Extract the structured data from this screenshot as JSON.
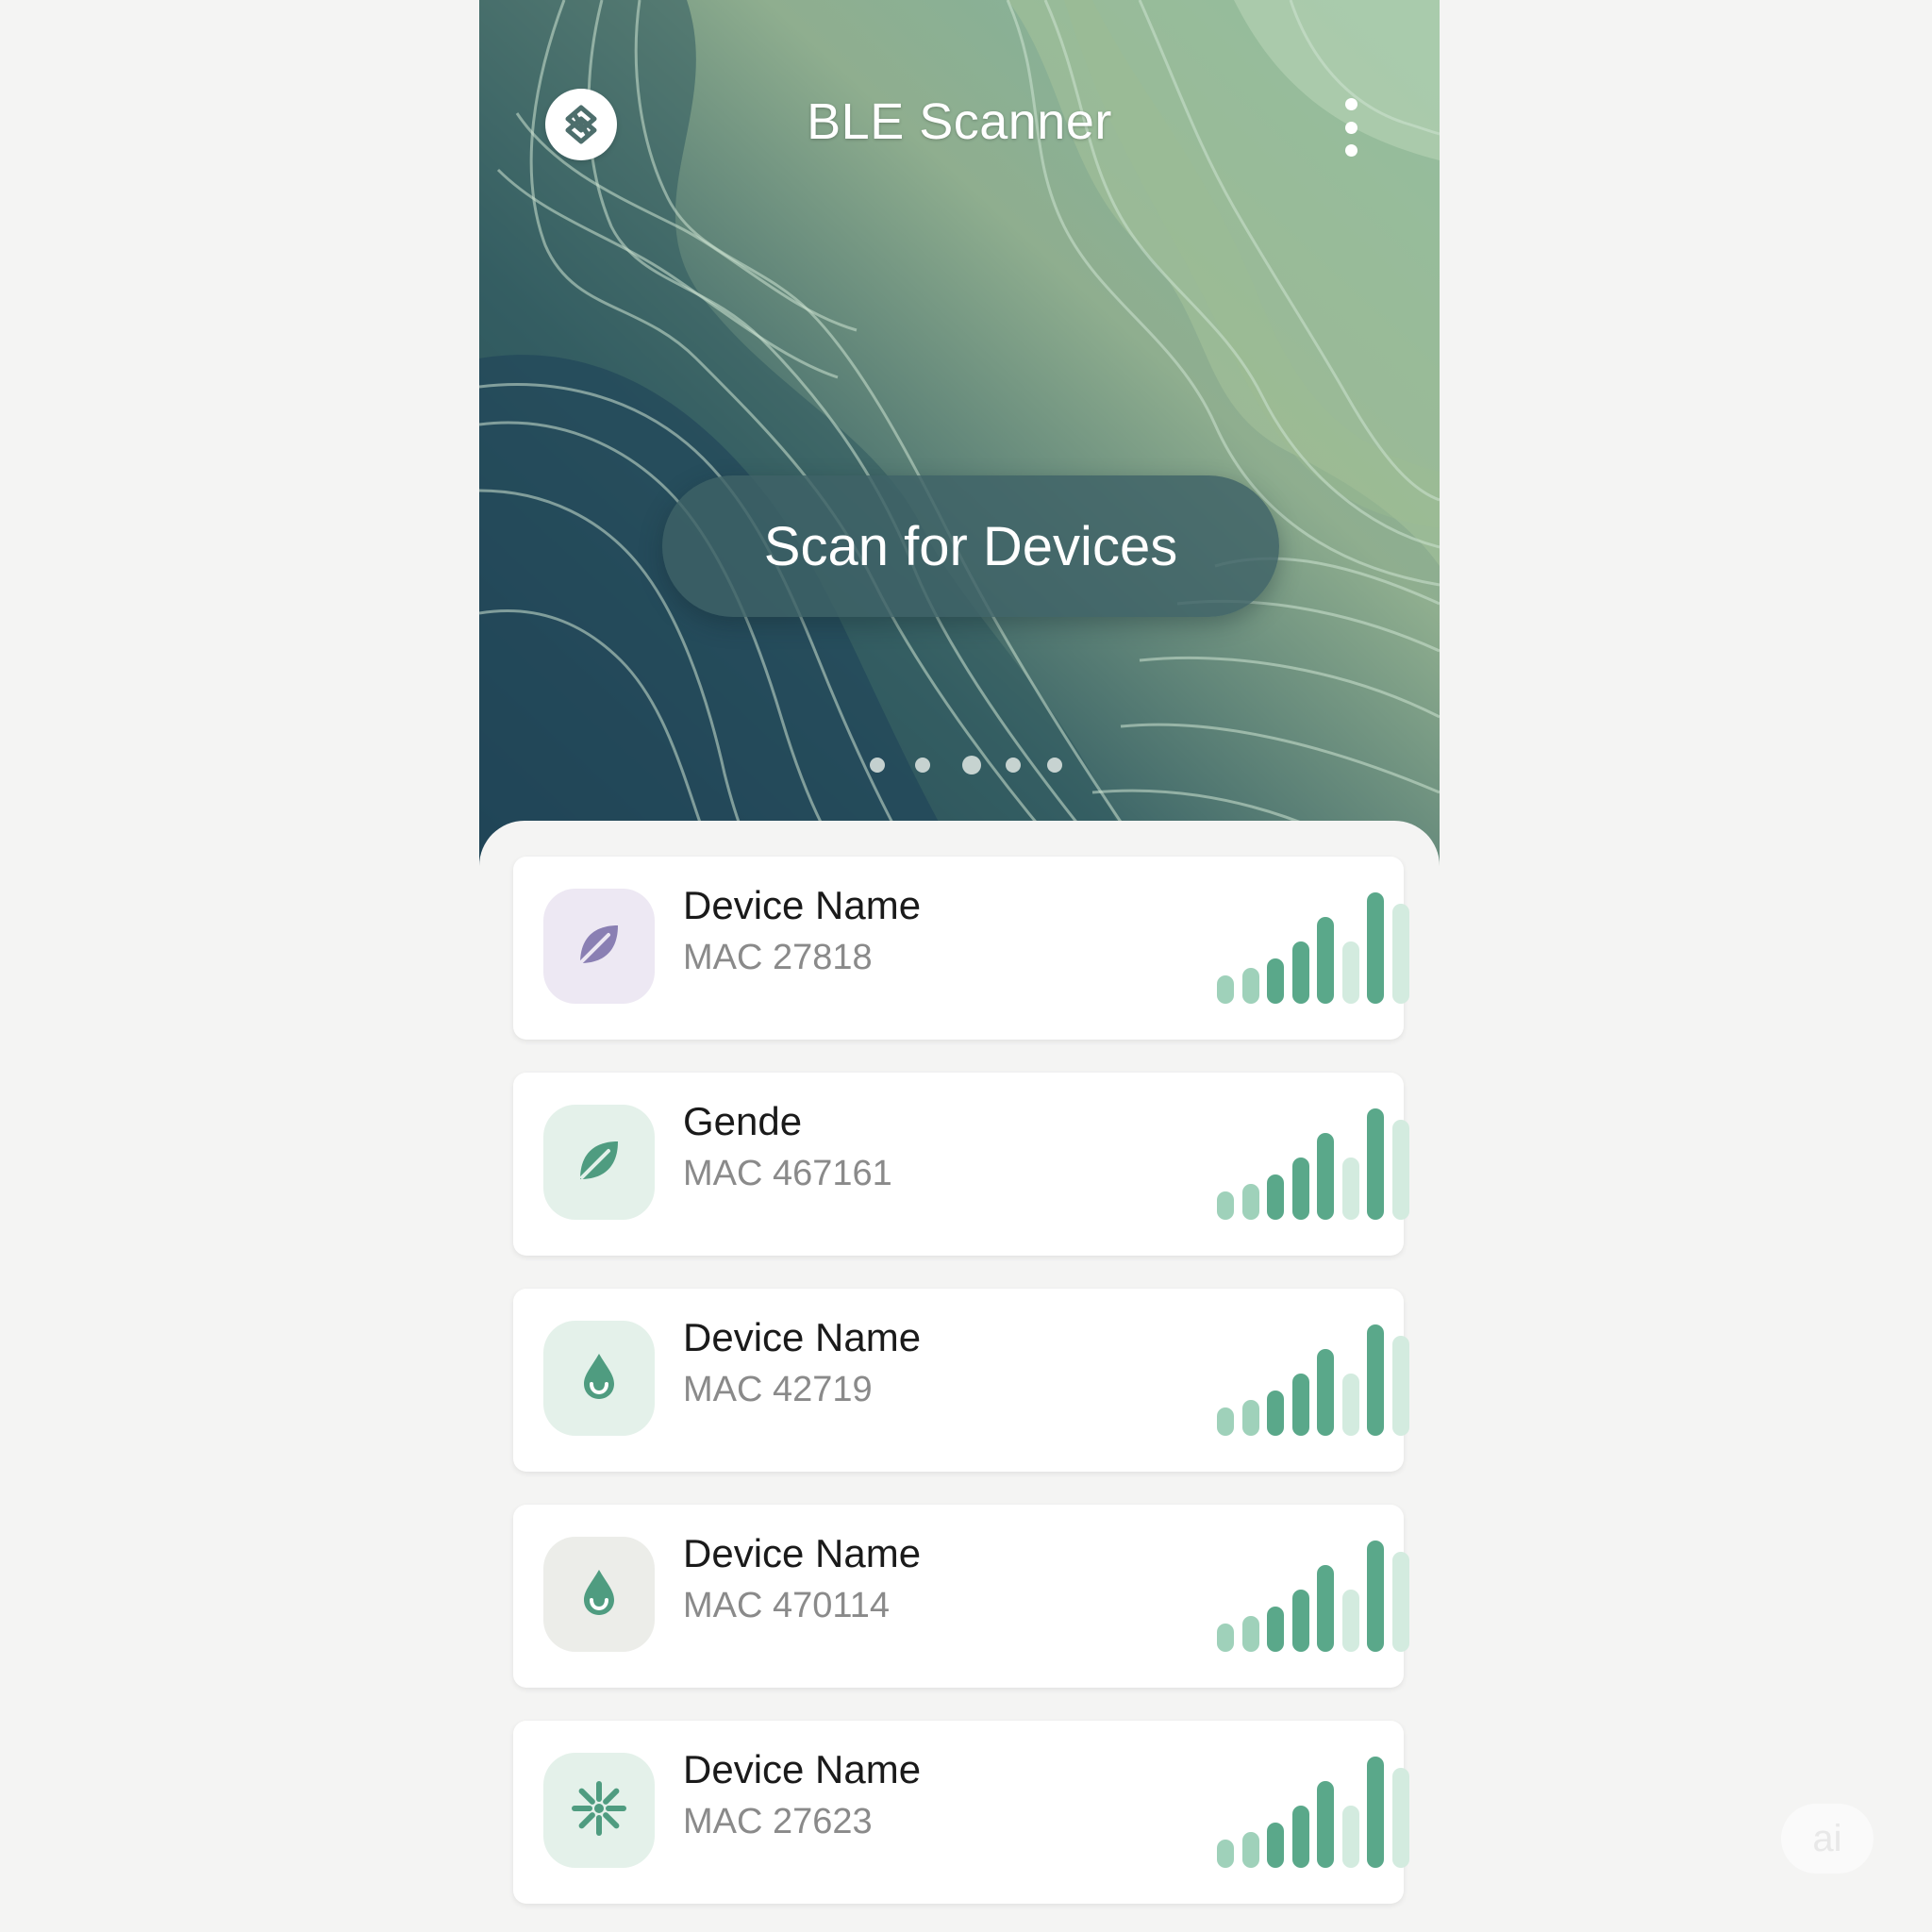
{
  "header": {
    "title": "BLE Scanner",
    "logo_icon": "bluetooth-scanner-logo-icon",
    "menu_icon": "more-vertical-icon"
  },
  "hero": {
    "scan_button_label": "Scan for Devices",
    "pager": {
      "pages": 5,
      "active_index": 2
    }
  },
  "devices": [
    {
      "name": "Device Name",
      "mac": "MAC 27818",
      "icon": "leaf-outline-icon",
      "icon_bg": "#ede8f3",
      "icon_color": "#8a7fb3",
      "signal_bars": 8
    },
    {
      "name": "Gende",
      "mac": "MAC 467161",
      "icon": "leaf-icon",
      "icon_bg": "#e4f1ea",
      "icon_color": "#4f9c80",
      "signal_bars": 8
    },
    {
      "name": "Device Name",
      "mac": "MAC 42719",
      "icon": "water-drop-icon",
      "icon_bg": "#e4f1ea",
      "icon_color": "#4f9c80",
      "signal_bars": 8
    },
    {
      "name": "Device Name",
      "mac": "MAC 470114",
      "icon": "water-drop-icon",
      "icon_bg": "#ecede9",
      "icon_color": "#4f9c80",
      "signal_bars": 8
    },
    {
      "name": "Device Name",
      "mac": "MAC 27623",
      "icon": "sparkle-icon",
      "icon_bg": "#e4f1ea",
      "icon_color": "#4f9c80",
      "signal_bars": 8
    }
  ],
  "watermark": {
    "text": "ai"
  },
  "colors": {
    "accent": "#5aa88a",
    "button": "#3e6266",
    "signal_dark": "#5aa88a",
    "signal_light": "#d3ebdf"
  }
}
